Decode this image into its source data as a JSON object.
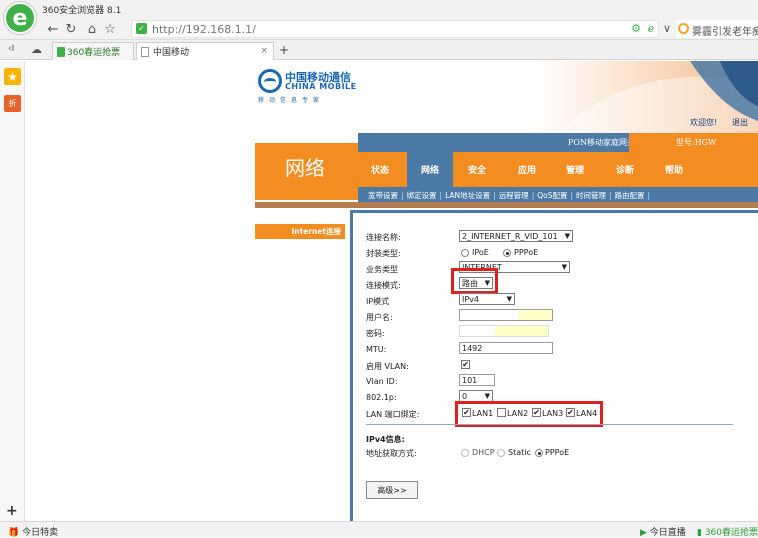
{
  "browser": {
    "window_title": "360安全浏览器 8.1",
    "url": "http://192.168.1.1/",
    "search_text": "雾霾引发老年痴",
    "tabs": [
      {
        "label": "360春运抢票"
      },
      {
        "label": "中国移动"
      }
    ],
    "tab_close": "×",
    "new_tab": "+",
    "sidebar_deal_label": "折",
    "status_left": "今日特卖",
    "status_right_1": "今日直播",
    "status_right_2": "360春运抢票"
  },
  "router": {
    "brand_cn": "中国移动通信",
    "brand_en": "CHINA MOBILE",
    "slogan": "移动信息专家",
    "welcome": "欢迎您!",
    "logout": "退出",
    "device_name": "PON移动家庭网关",
    "model": "型号:HGW",
    "section_title": "网络",
    "menu": [
      "状态",
      "网络",
      "安全",
      "应用",
      "管理",
      "诊断",
      "帮助"
    ],
    "active_menu": "网络",
    "submenu": [
      "宽带设置",
      "绑定设置",
      "LAN地址设置",
      "远程管理",
      "QoS配置",
      "时间管理",
      "路由配置"
    ],
    "submenu_sep": "|",
    "left_tab": "Internet连接"
  },
  "form": {
    "connection_name_label": "连接名称:",
    "connection_name_value": "2_INTERNET_R_VID_101",
    "encap_label": "封装类型:",
    "encap_options": [
      "IPoE",
      "PPPoE"
    ],
    "encap_selected": "PPPoE",
    "service_label": "业务类型",
    "service_value": "INTERNET",
    "mode_label": "连接模式:",
    "mode_value": "路由",
    "ip_mode_label": "IP模式",
    "ip_mode_value": "IPv4",
    "username_label": "用户名:",
    "password_label": "密码:",
    "mtu_label": "MTU:",
    "mtu_value": "1492",
    "vlan_enable_label": "启用 VLAN:",
    "vlan_id_label": "Vlan ID:",
    "vlan_id_value": "101",
    "priority_label": "802.1p:",
    "priority_value": "0",
    "lan_bind_label": "LAN 端口绑定:",
    "lan_ports": [
      {
        "name": "LAN1",
        "checked": true
      },
      {
        "name": "LAN2",
        "checked": false
      },
      {
        "name": "LAN3",
        "checked": true
      },
      {
        "name": "LAN4",
        "checked": true
      }
    ],
    "ipv4_info_label": "IPv4信息:",
    "addr_method_label": "地址获取方式:",
    "addr_options": [
      "DHCP",
      "Static",
      "PPPoE"
    ],
    "addr_selected": "PPPoE",
    "advanced_button": "高级>>",
    "check_mark": "✔"
  }
}
